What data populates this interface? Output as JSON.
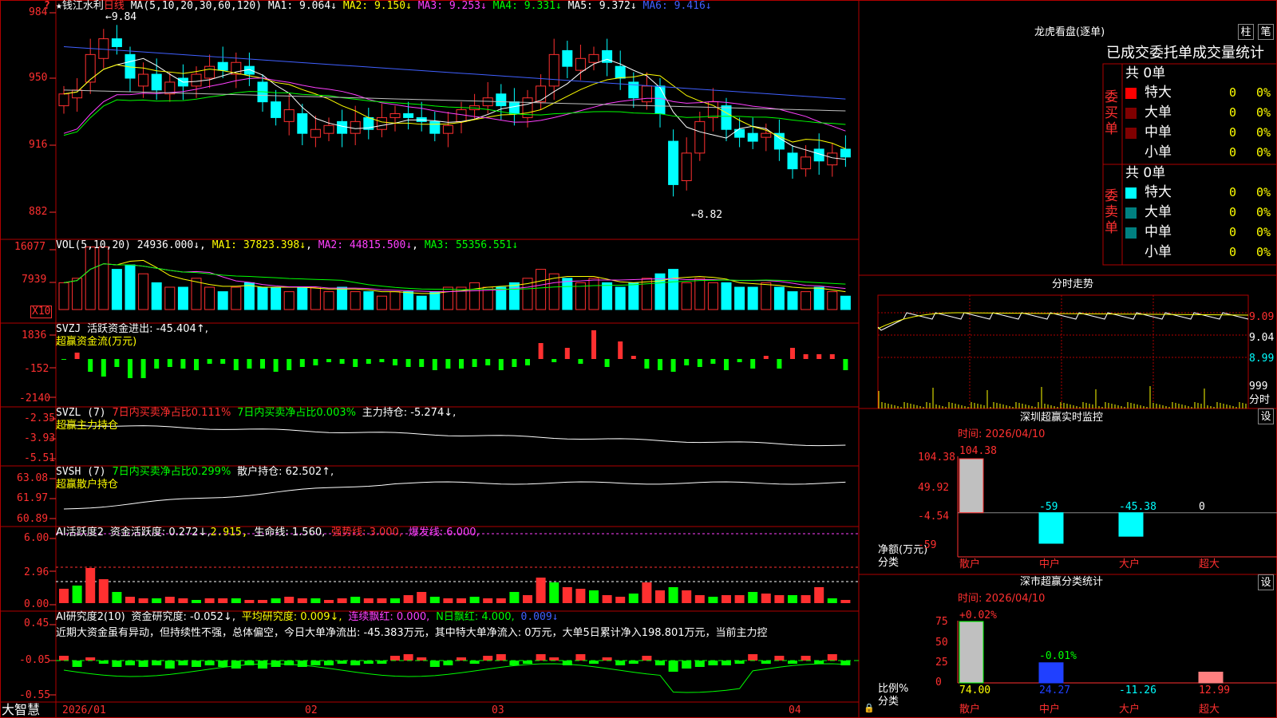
{
  "app": {
    "name": "大智慧"
  },
  "kline": {
    "stock": "钱江水利",
    "period": "日线",
    "ma_label": "MA(5,10,20,30,60,120)",
    "ma1": "MA1: 9.064↓",
    "ma2": "MA2: 9.150↓",
    "ma3": "MA3: 9.253↓",
    "ma4": "MA4: 9.331↓",
    "ma5": "MA5: 9.372↓",
    "ma6": "MA6: 9.416↓",
    "y_ticks": [
      "984",
      "950",
      "916",
      "882"
    ],
    "high_note": "9.84",
    "low_note": "8.82"
  },
  "vol": {
    "label": "VOL(5,10,20)",
    "value": "24936.000↓",
    "ma1": "MA1: 37823.398↓",
    "ma2": "MA2: 44815.500↓",
    "ma3": "MA3: 55356.551↓",
    "y_ticks": [
      "16077",
      "7939"
    ],
    "unit": "X10"
  },
  "svzj": {
    "label": "SVZJ",
    "value": "活跃资金进出: -45.404↑,",
    "title": "超赢资金流(万元)",
    "y_ticks": [
      "1836",
      "-152",
      "-2140"
    ]
  },
  "svzl": {
    "label": "SVZL (7)",
    "a": "7日内买卖净占比0.111%",
    "b": "7日内买卖净占比0.003%",
    "c": "主力持仓: -5.274↓,",
    "title": "超赢主力持仓",
    "y_ticks": [
      "-2.35",
      "-3.93",
      "-5.51"
    ]
  },
  "svsh": {
    "label": "SVSH (7)",
    "a": "7日内买卖净占比0.299%",
    "b": "散户持仓: 62.502↑,",
    "title": "超赢散户持仓",
    "y_ticks": [
      "63.08",
      "61.97",
      "60.89"
    ]
  },
  "ai1": {
    "label": "AI活跃度2",
    "a": "资金活跃度: 0.272↓,",
    "b": "2.915,",
    "c": "生命线: 1.560,",
    "d": "强势线: 3.000,",
    "e": "爆发线: 6.000,",
    "y_ticks": [
      "6.00",
      "2.96",
      "0.00"
    ]
  },
  "ai2": {
    "label": "AI研究度2(10)",
    "a": "资金研究度: -0.052↓,",
    "b": "平均研究度: 0.009↓,",
    "c": "连续飘红: 0.000,",
    "d": "N日飘红: 4.000,",
    "e": "0.009↓",
    "comment": "近期大资金虽有异动，但持续性不强，总体偏空，今日大单净流出: -45.383万元，其中特大单净流入: 0万元，大单5日累计净入198.801万元，当前主力控",
    "y_ticks": [
      "0.45",
      "-0.05",
      "-0.55"
    ]
  },
  "xaxis": {
    "labels": [
      "2026/01",
      "02",
      "03",
      "04"
    ]
  },
  "lhb": {
    "title": "龙虎看盘(逐单)",
    "btn_column": "柱",
    "btn_pen": "笔",
    "header": "已成交委托单成交量统计",
    "buy_side": "委买单",
    "sell_side": "委卖单",
    "buy_total": "共 0单",
    "sell_total": "共 0单",
    "rows": [
      {
        "name": "特大",
        "count": "0",
        "pct": "0%"
      },
      {
        "name": "大单",
        "count": "0",
        "pct": "0%"
      },
      {
        "name": "中单",
        "count": "0",
        "pct": "0%"
      },
      {
        "name": "小单",
        "count": "0",
        "pct": "0%"
      }
    ]
  },
  "fenshi": {
    "title": "分时走势",
    "y_ticks": [
      "9.09",
      "9.04",
      "8.99"
    ],
    "vol_tick": "999",
    "footer": "分时"
  },
  "monitor": {
    "title": "深圳超赢实时监控",
    "set_btn": "设",
    "date": "时间: 2026/04/10",
    "y_ticks": [
      "104.38",
      "49.92",
      "-4.54",
      "-59"
    ],
    "y_label": "净额(万元)",
    "x_label": "分类",
    "cats": [
      "散户",
      "中户",
      "大户",
      "超大"
    ],
    "values": [
      104.38,
      -59,
      -45.38,
      0
    ],
    "value_labels": [
      "104.38",
      "-59",
      "-45.38",
      "0"
    ]
  },
  "classify": {
    "title": "深市超赢分类统计",
    "set_btn": "设",
    "date": "时间: 2026/04/10",
    "y_ticks": [
      "75",
      "50",
      "25",
      "0"
    ],
    "y_label": "比例%",
    "x_label": "分类",
    "cats": [
      "散户",
      "中户",
      "大户",
      "超大"
    ],
    "values": [
      74.0,
      24.27,
      -11.26,
      12.99
    ],
    "value_labels": [
      "74.00",
      "24.27",
      "-11.26",
      "12.99"
    ],
    "top_labels": [
      "+0.02%",
      "-0.01%"
    ]
  },
  "colors": {
    "up": "#ff3030",
    "down": "#00ffff",
    "grid": "#b00000"
  }
}
